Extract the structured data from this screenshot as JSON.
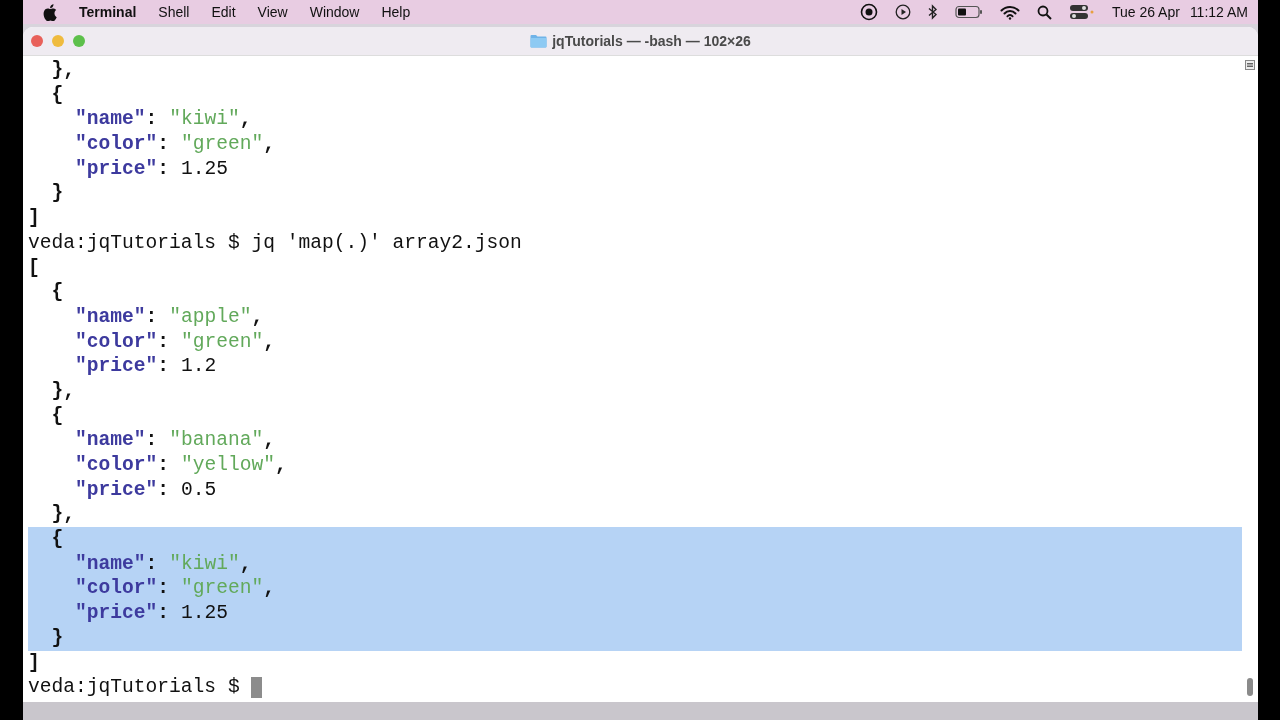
{
  "menu_bar": {
    "app_name": "Terminal",
    "menus": [
      "Shell",
      "Edit",
      "View",
      "Window",
      "Help"
    ],
    "date": "Tue 26 Apr",
    "time": "11:12 AM"
  },
  "window": {
    "title": "jqTutorials — -bash — 102×26"
  },
  "terminal": {
    "lines": [
      {
        "selected": false,
        "tokens": [
          {
            "kind": "punct",
            "text": "  },"
          }
        ]
      },
      {
        "selected": false,
        "tokens": [
          {
            "kind": "punct",
            "text": "  {"
          }
        ]
      },
      {
        "selected": false,
        "tokens": [
          {
            "kind": "key",
            "text": "    \"name\""
          },
          {
            "kind": "punct",
            "text": ": "
          },
          {
            "kind": "string",
            "text": "\"kiwi\""
          },
          {
            "kind": "punct",
            "text": ","
          }
        ]
      },
      {
        "selected": false,
        "tokens": [
          {
            "kind": "key",
            "text": "    \"color\""
          },
          {
            "kind": "punct",
            "text": ": "
          },
          {
            "kind": "string",
            "text": "\"green\""
          },
          {
            "kind": "punct",
            "text": ","
          }
        ]
      },
      {
        "selected": false,
        "tokens": [
          {
            "kind": "key",
            "text": "    \"price\""
          },
          {
            "kind": "punct",
            "text": ": "
          },
          {
            "kind": "number",
            "text": "1.25"
          }
        ]
      },
      {
        "selected": false,
        "tokens": [
          {
            "kind": "punct",
            "text": "  }"
          }
        ]
      },
      {
        "selected": false,
        "tokens": [
          {
            "kind": "punct",
            "text": "]"
          }
        ]
      },
      {
        "selected": false,
        "tokens": [
          {
            "kind": "prompt",
            "text": "veda:jqTutorials $ jq 'map(.)' array2.json"
          }
        ]
      },
      {
        "selected": false,
        "tokens": [
          {
            "kind": "punct",
            "text": "["
          }
        ]
      },
      {
        "selected": false,
        "tokens": [
          {
            "kind": "punct",
            "text": "  {"
          }
        ]
      },
      {
        "selected": false,
        "tokens": [
          {
            "kind": "key",
            "text": "    \"name\""
          },
          {
            "kind": "punct",
            "text": ": "
          },
          {
            "kind": "string",
            "text": "\"apple\""
          },
          {
            "kind": "punct",
            "text": ","
          }
        ]
      },
      {
        "selected": false,
        "tokens": [
          {
            "kind": "key",
            "text": "    \"color\""
          },
          {
            "kind": "punct",
            "text": ": "
          },
          {
            "kind": "string",
            "text": "\"green\""
          },
          {
            "kind": "punct",
            "text": ","
          }
        ]
      },
      {
        "selected": false,
        "tokens": [
          {
            "kind": "key",
            "text": "    \"price\""
          },
          {
            "kind": "punct",
            "text": ": "
          },
          {
            "kind": "number",
            "text": "1.2"
          }
        ]
      },
      {
        "selected": false,
        "tokens": [
          {
            "kind": "punct",
            "text": "  },"
          }
        ]
      },
      {
        "selected": false,
        "tokens": [
          {
            "kind": "punct",
            "text": "  {"
          }
        ]
      },
      {
        "selected": false,
        "tokens": [
          {
            "kind": "key",
            "text": "    \"name\""
          },
          {
            "kind": "punct",
            "text": ": "
          },
          {
            "kind": "string",
            "text": "\"banana\""
          },
          {
            "kind": "punct",
            "text": ","
          }
        ]
      },
      {
        "selected": false,
        "tokens": [
          {
            "kind": "key",
            "text": "    \"color\""
          },
          {
            "kind": "punct",
            "text": ": "
          },
          {
            "kind": "string",
            "text": "\"yellow\""
          },
          {
            "kind": "punct",
            "text": ","
          }
        ]
      },
      {
        "selected": false,
        "tokens": [
          {
            "kind": "key",
            "text": "    \"price\""
          },
          {
            "kind": "punct",
            "text": ": "
          },
          {
            "kind": "number",
            "text": "0.5"
          }
        ]
      },
      {
        "selected": false,
        "tokens": [
          {
            "kind": "punct",
            "text": "  },"
          }
        ]
      },
      {
        "selected": true,
        "tokens": [
          {
            "kind": "punct",
            "text": "  {"
          }
        ]
      },
      {
        "selected": true,
        "tokens": [
          {
            "kind": "key",
            "text": "    \"name\""
          },
          {
            "kind": "punct",
            "text": ": "
          },
          {
            "kind": "string",
            "text": "\"kiwi\""
          },
          {
            "kind": "punct",
            "text": ","
          }
        ]
      },
      {
        "selected": true,
        "tokens": [
          {
            "kind": "key",
            "text": "    \"color\""
          },
          {
            "kind": "punct",
            "text": ": "
          },
          {
            "kind": "string",
            "text": "\"green\""
          },
          {
            "kind": "punct",
            "text": ","
          }
        ]
      },
      {
        "selected": true,
        "tokens": [
          {
            "kind": "key",
            "text": "    \"price\""
          },
          {
            "kind": "punct",
            "text": ": "
          },
          {
            "kind": "number",
            "text": "1.25"
          }
        ]
      },
      {
        "selected": true,
        "tokens": [
          {
            "kind": "punct",
            "text": "  }"
          }
        ]
      },
      {
        "selected": false,
        "tokens": [
          {
            "kind": "punct",
            "text": "]"
          }
        ]
      },
      {
        "selected": false,
        "cursor": true,
        "tokens": [
          {
            "kind": "prompt",
            "text": "veda:jqTutorials $ "
          }
        ]
      }
    ]
  }
}
